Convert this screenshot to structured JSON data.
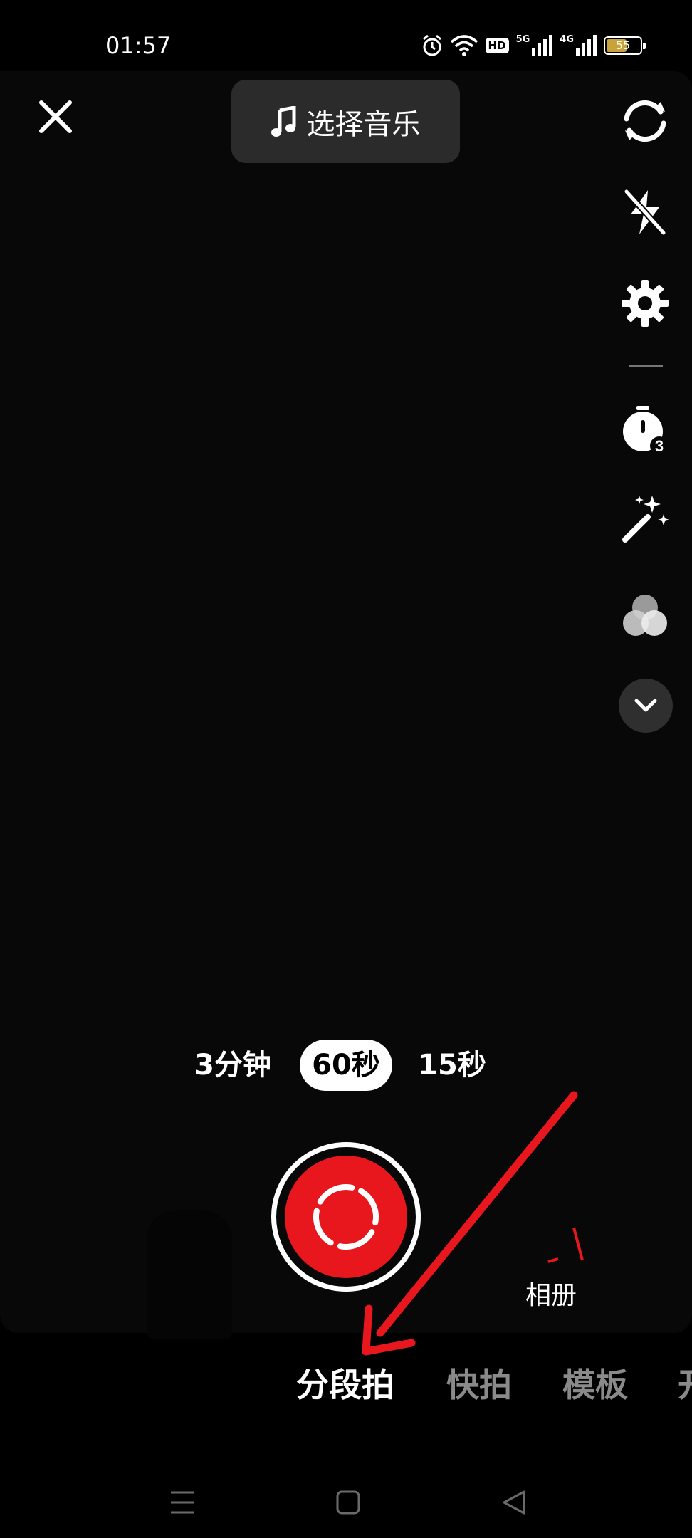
{
  "status_bar": {
    "time": "01:57",
    "hd_label": "HD",
    "network_5g": "5G",
    "network_4g": "4G",
    "battery_level": "55"
  },
  "top_bar": {
    "close_icon": "close-icon",
    "music_button_label": "选择音乐",
    "music_icon": "music-note-icon"
  },
  "side_tools": [
    {
      "name": "flip-camera",
      "icon": "flip-camera-icon"
    },
    {
      "name": "flash-off",
      "icon": "flash-off-icon"
    },
    {
      "name": "settings",
      "icon": "gear-icon"
    },
    {
      "name": "timer",
      "icon": "timer-3-icon",
      "badge": "3"
    },
    {
      "name": "beauty",
      "icon": "magic-wand-icon"
    },
    {
      "name": "filters",
      "icon": "filter-circles-icon"
    },
    {
      "name": "more",
      "icon": "chevron-down-icon"
    }
  ],
  "durations": {
    "options": [
      "3分钟",
      "60秒",
      "15秒"
    ],
    "selected": "60秒"
  },
  "shutter": {
    "icon": "segmented-record-icon",
    "color": "#e8171e"
  },
  "album": {
    "label": "相册"
  },
  "modes": {
    "items": [
      "分段拍",
      "快拍",
      "模板",
      "开"
    ],
    "selected": "分段拍"
  },
  "annotation": {
    "color": "#e8171e"
  },
  "nav_bar": {
    "menu_icon": "menu-icon",
    "home_icon": "home-square-icon",
    "back_icon": "back-triangle-icon"
  }
}
